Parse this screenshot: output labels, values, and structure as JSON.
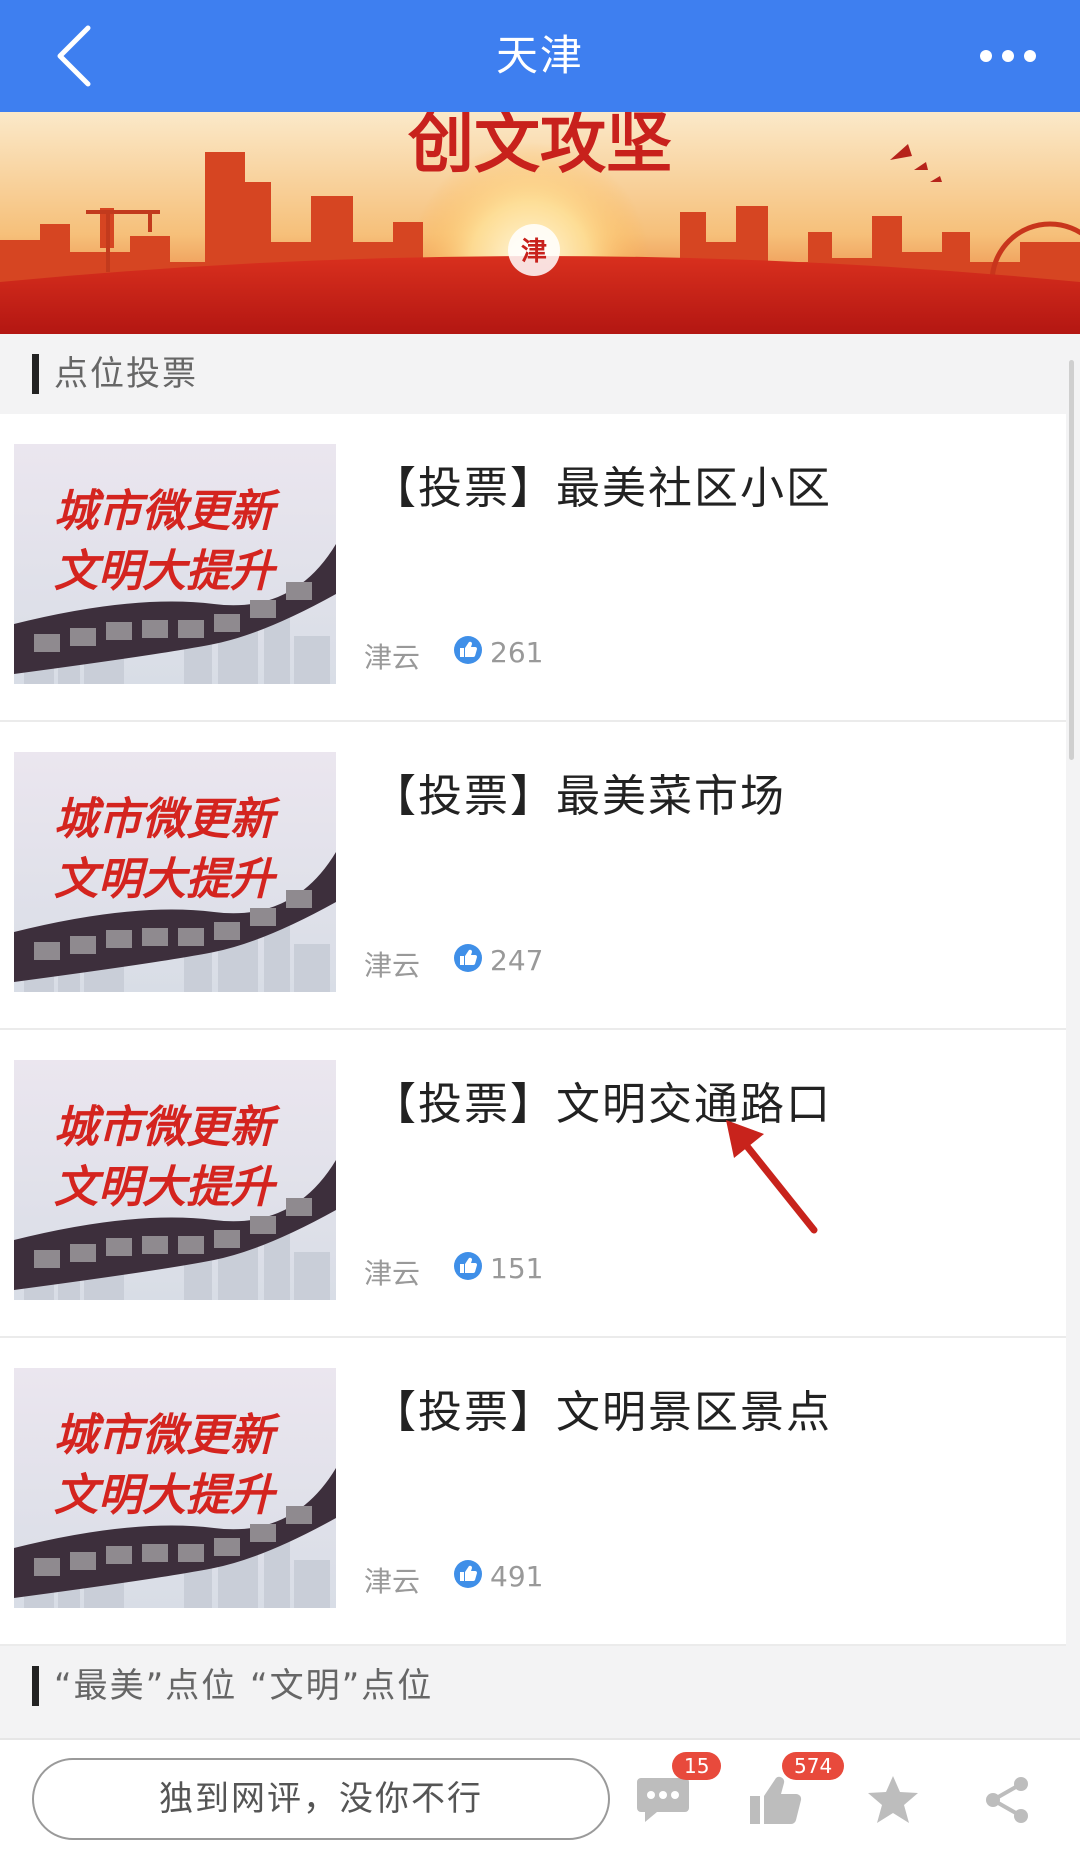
{
  "header": {
    "title": "天津",
    "back_icon": "chevron-left-icon",
    "more_icon": "more-dots-icon",
    "bar_color": "#3e7ff0"
  },
  "banner": {
    "text": "创文攻坚",
    "logo_text": "津"
  },
  "sections": [
    {
      "label": "点位投票"
    },
    {
      "label": "“最美”点位  “文明”点位"
    }
  ],
  "thumbnail": {
    "line1": "城市微更新",
    "line2": "文明大提升"
  },
  "items": [
    {
      "title": "【投票】最美社区小区",
      "source": "津云",
      "likes": "261"
    },
    {
      "title": "【投票】最美菜市场",
      "source": "津云",
      "likes": "247"
    },
    {
      "title": "【投票】文明交通路口",
      "source": "津云",
      "likes": "151"
    },
    {
      "title": "【投票】文明景区景点",
      "source": "津云",
      "likes": "491"
    }
  ],
  "bottom_bar": {
    "comment_placeholder": "独到网评，没你不行",
    "comment_count": "15",
    "like_count": "574",
    "icons": [
      "comment-icon",
      "thumbs-up-icon",
      "star-icon",
      "share-icon"
    ]
  },
  "colors": {
    "accent_blue": "#3e7ff0",
    "like_blue": "#3f8fe8",
    "badge_red": "#e84a3c",
    "annotation_red": "#c8231c"
  }
}
